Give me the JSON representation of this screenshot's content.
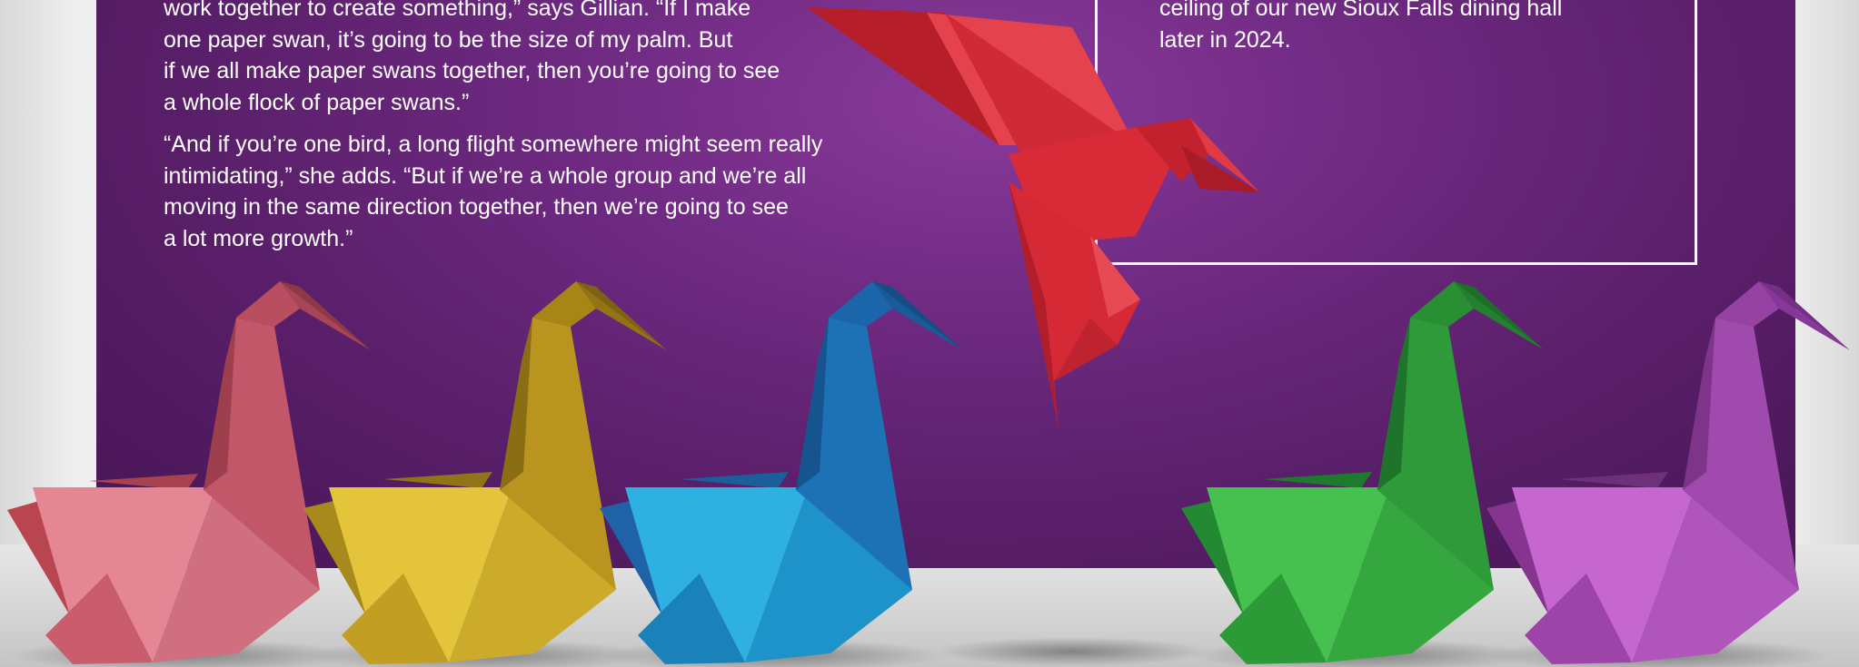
{
  "article": {
    "paragraph_1": "work together to create something,” says Gillian. “If I make\none paper swan, it’s going to be the size of my palm. But\nif we all make paper swans together, then you’re going to see\na whole flock of paper swans.”",
    "paragraph_2": "“And if you’re one bird, a long flight somewhere might seem really\nintimidating,” she adds. “But if we’re a whole group and we’re all\nmoving in the same direction together, then we’re going to see\na lot more growth.”"
  },
  "callout": {
    "text": "ceiling of our new Sioux Falls dining hall\nlater in 2024."
  },
  "colors": {
    "panel": "#6a2680",
    "text": "#ffffff",
    "swans": [
      "#e07f8e",
      "#d9b62e",
      "#1fa4d8",
      "#3cb84a",
      "#b85ac4"
    ],
    "flying_bird": "#dc2a35"
  },
  "illustration": {
    "swans": [
      {
        "name": "pink-swan",
        "color": "pink"
      },
      {
        "name": "yellow-swan",
        "color": "yellow"
      },
      {
        "name": "blue-swan",
        "color": "blue"
      },
      {
        "name": "green-swan",
        "color": "green"
      },
      {
        "name": "purple-swan",
        "color": "purple"
      }
    ],
    "flying_bird": "red-origami-bird-icon"
  }
}
